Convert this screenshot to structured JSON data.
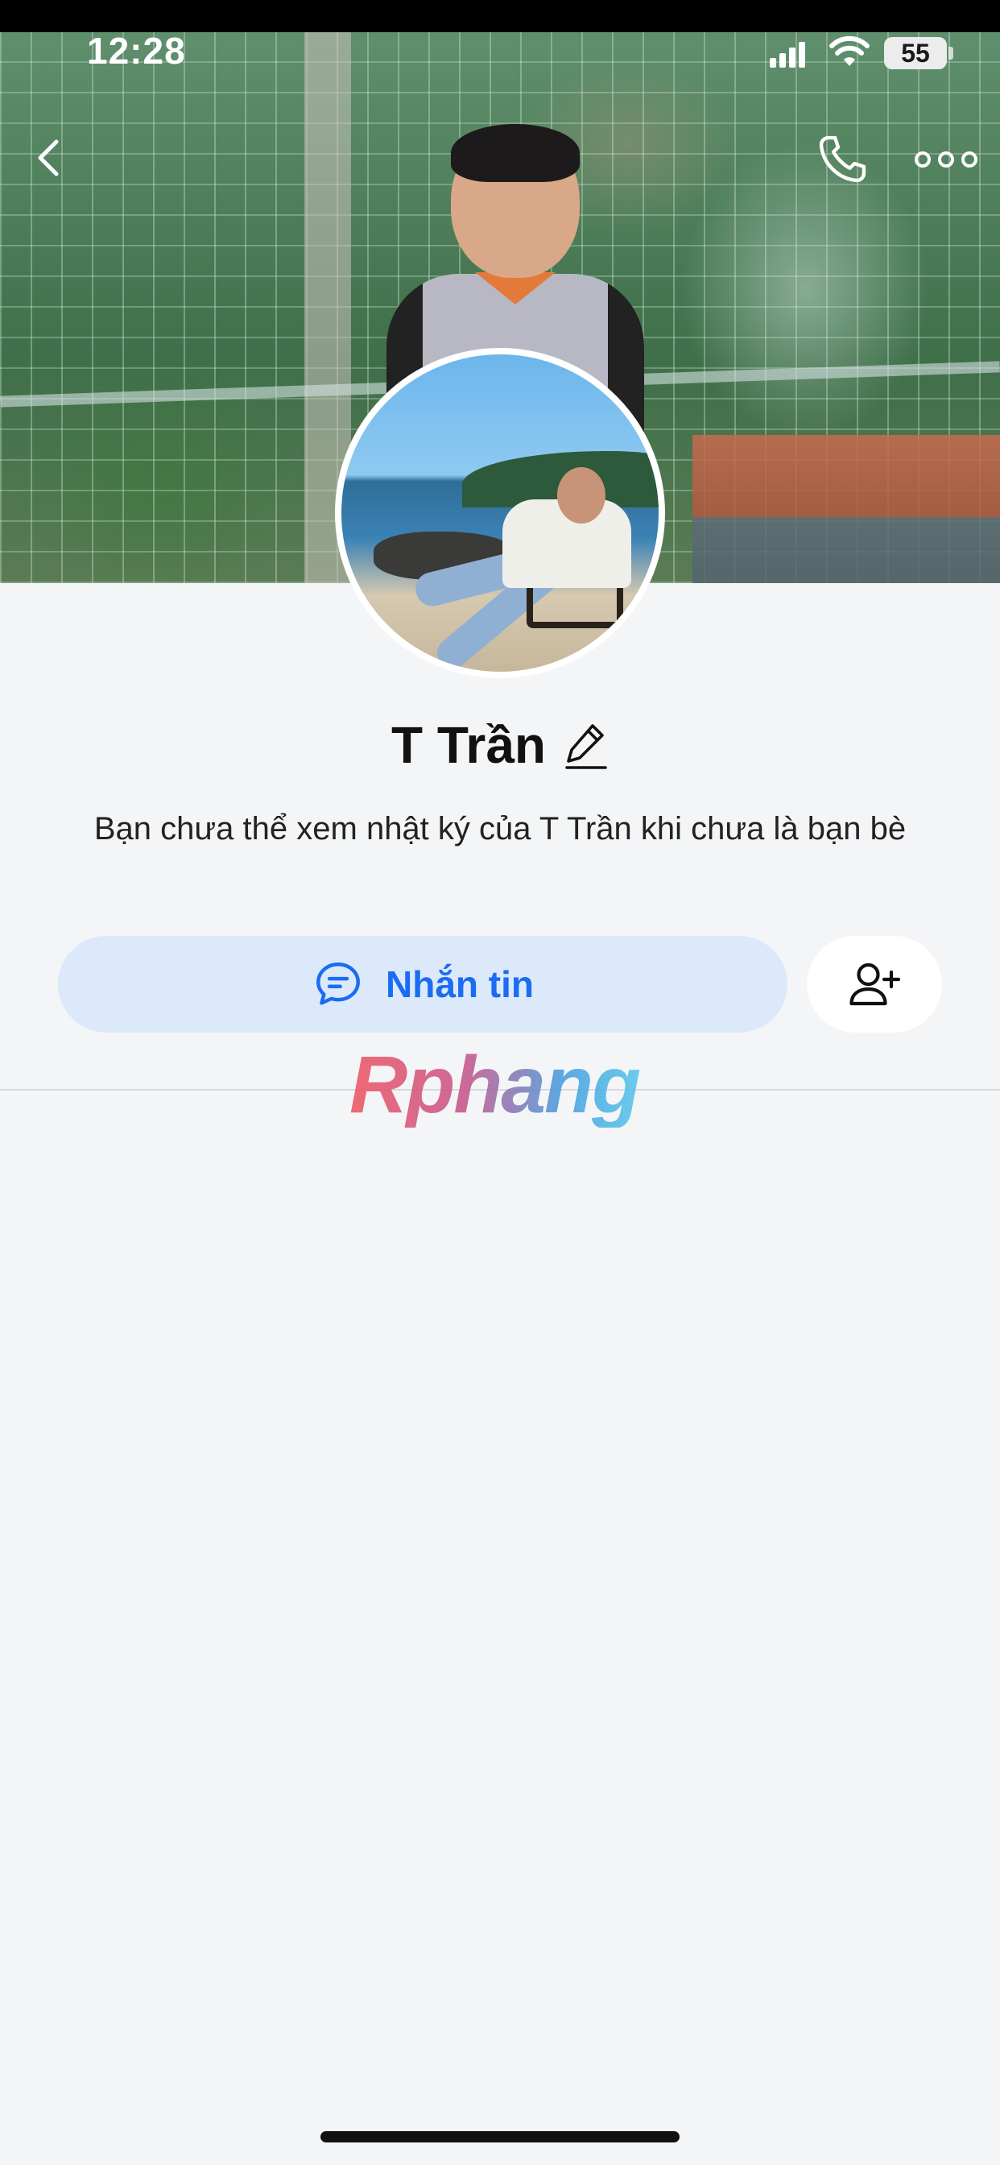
{
  "status_bar": {
    "time": "12:28",
    "battery_level": "55"
  },
  "header": {
    "back_icon": "chevron-left-icon",
    "call_icon": "phone-icon",
    "more_icon": "more-dots-icon"
  },
  "profile": {
    "name": "T Trần",
    "edit_icon": "pencil-icon",
    "privacy_note": "Bạn chưa thể xem nhật ký của T Trần khi chưa là bạn bè"
  },
  "actions": {
    "message_label": "Nhắn tin",
    "message_icon": "chat-bubble-icon",
    "add_friend_icon": "add-user-icon"
  },
  "watermark": {
    "text": "Rphang"
  },
  "colors": {
    "accent": "#1b6cf2",
    "message_button_bg": "#dce9fb",
    "page_bg": "#f4f5f7"
  }
}
